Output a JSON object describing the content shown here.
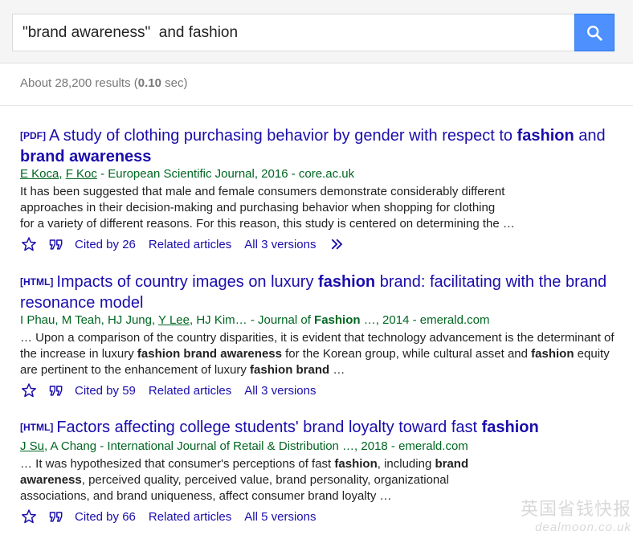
{
  "search": {
    "query": "\"brand awareness\"  and fashion",
    "button_icon": "search-icon"
  },
  "stats": {
    "prefix": "About 28,200 results (",
    "time": "0.10",
    "suffix": " sec)"
  },
  "results": [
    {
      "tag": "[PDF]",
      "title_parts": [
        "A study of clothing purchasing behavior by gender with respect to ",
        "fashion",
        " and ",
        "brand awareness"
      ],
      "authors": [
        "E Koca",
        ", ",
        "F Koc"
      ],
      "source": " - European Scientific Journal, 2016 - core.ac.uk",
      "snippet": [
        "It has been suggested that male and female consumers demonstrate considerably different",
        "approaches in their decision-making and purchasing behavior when shopping for clothing",
        "for a variety of different reasons. For this reason, this study is centered on determining the …"
      ],
      "cited": "Cited by 26",
      "related": "Related articles",
      "versions": "All 3 versions"
    },
    {
      "tag": "[HTML]",
      "title_parts": [
        "Impacts of country images on luxury ",
        "fashion",
        " brand: facilitating with the brand resonance model"
      ],
      "authors_pre": "I Phau, M Teah, HJ Jung, ",
      "authors_link": "Y Lee",
      "authors_post": ", HJ Kim… - Journal of ",
      "journal_bold": "Fashion",
      "source": " …, 2014 - emerald.com",
      "snippet_a": "… Upon a comparison of the country disparities, it is evident that technology advancement is the determinant of the increase in luxury ",
      "snippet_b1": "fashion brand awareness",
      "snippet_c": " for the Korean group, while cultural asset and ",
      "snippet_b2": "fashion",
      "snippet_d": " equity are pertinent to the enhancement of luxury ",
      "snippet_b3": "fashion brand",
      "snippet_e": " …",
      "cited": "Cited by 59",
      "related": "Related articles",
      "versions": "All 3 versions"
    },
    {
      "tag": "[HTML]",
      "title_parts": [
        "Factors affecting college students' brand loyalty toward fast ",
        "fashion"
      ],
      "authors_link": "J Su",
      "source": ", A Chang - International Journal of Retail & Distribution …, 2018 - emerald.com",
      "snippet_a": "… It was hypothesized that consumer's perceptions of fast ",
      "snippet_b1": "fashion",
      "snippet_c": ", including ",
      "snippet_b2": "brand awareness",
      "snippet_d": ", perceived quality, perceived value, brand personality, organizational associations, and brand uniqueness, affect consumer brand loyalty …",
      "cited": "Cited by 66",
      "related": "Related articles",
      "versions": "All 5 versions"
    }
  ],
  "watermark": {
    "cn": "英国省钱快报",
    "en": "dealmoon.co.uk"
  },
  "colors": {
    "link": "#1a0dab",
    "green": "#006621",
    "button": "#4d90fe"
  }
}
